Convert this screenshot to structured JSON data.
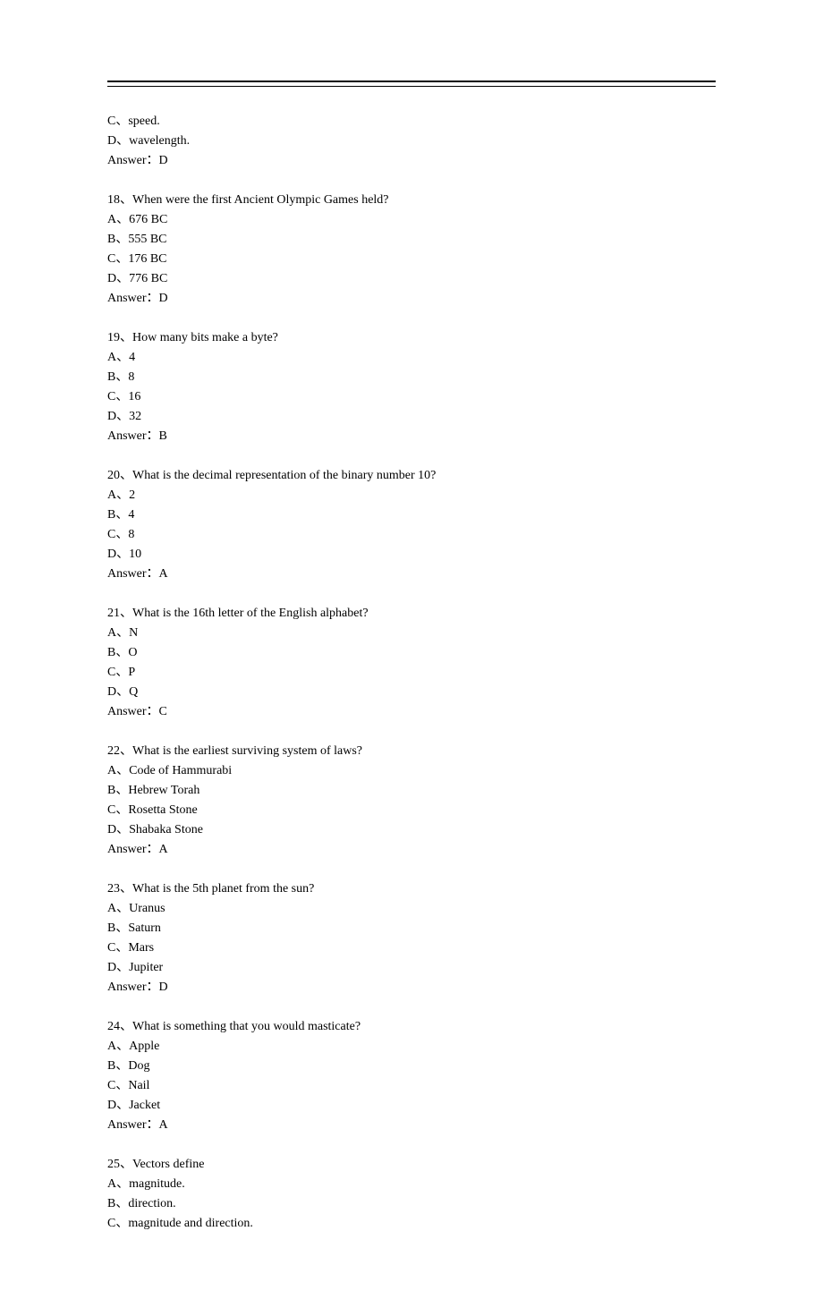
{
  "fragment": {
    "optC": "C、speed.",
    "optD": "D、wavelength.",
    "answer": "Answer：D"
  },
  "questions": [
    {
      "num": "18",
      "text": "When were the first Ancient Olympic Games held?",
      "opts": [
        "A、676 BC",
        "B、555 BC",
        "C、176 BC",
        "D、776 BC"
      ],
      "answer": "Answer：D"
    },
    {
      "num": "19",
      "text": "How many bits make a byte?",
      "opts": [
        "A、4",
        "B、8",
        "C、16",
        "D、32"
      ],
      "answer": "Answer：B"
    },
    {
      "num": "20",
      "text": "What is the decimal representation of the binary number 10?",
      "opts": [
        "A、2",
        "B、4",
        "C、8",
        "D、10"
      ],
      "answer": "Answer：A"
    },
    {
      "num": "21",
      "text": "What is the 16th letter of the English alphabet?",
      "opts": [
        "A、N",
        "B、O",
        "C、P",
        "D、Q"
      ],
      "answer": "Answer：C"
    },
    {
      "num": "22",
      "text": "What is the earliest surviving system of laws?",
      "opts": [
        "A、Code of Hammurabi",
        "B、Hebrew Torah",
        "C、Rosetta Stone",
        "D、Shabaka Stone"
      ],
      "answer": "Answer：A"
    },
    {
      "num": "23",
      "text": "What is the 5th planet from the sun?",
      "opts": [
        "A、Uranus",
        "B、Saturn",
        "C、Mars",
        "D、Jupiter"
      ],
      "answer": "Answer：D"
    },
    {
      "num": "24",
      "text": "What is something that you would masticate?",
      "opts": [
        "A、Apple",
        "B、Dog",
        "C、Nail",
        "D、Jacket"
      ],
      "answer": "Answer：A"
    },
    {
      "num": "25",
      "text": "Vectors define",
      "opts": [
        "A、magnitude.",
        "B、direction.",
        "C、magnitude and direction."
      ],
      "answer": ""
    }
  ]
}
